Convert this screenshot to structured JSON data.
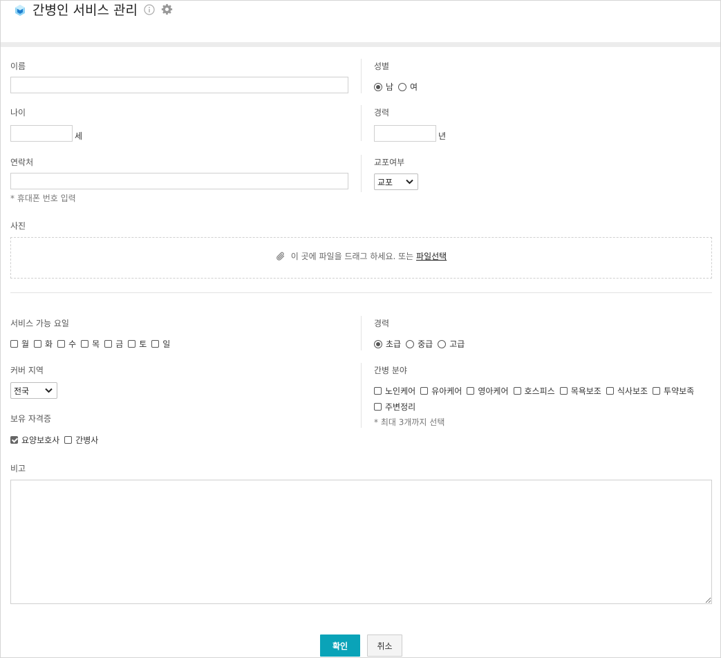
{
  "header": {
    "title": "간병인 서비스 관리"
  },
  "icons": {
    "logo": "app-logo-icon",
    "info": "info-icon",
    "settings": "gear-icon",
    "attach": "paperclip-icon",
    "dropdown": "chevron-down-icon"
  },
  "colors": {
    "primary": "#0aa3b8",
    "header_bar": "#ececec"
  },
  "form": {
    "name": {
      "label": "이름",
      "value": ""
    },
    "gender": {
      "label": "성별",
      "options": [
        "남",
        "여"
      ],
      "selected": "남"
    },
    "age": {
      "label": "나이",
      "value": "",
      "unit": "세"
    },
    "career_years": {
      "label": "경력",
      "value": "",
      "unit": "년"
    },
    "contact": {
      "label": "연락처",
      "value": "",
      "note": "* 휴대폰 번호 입력"
    },
    "korean_resident": {
      "label": "교포여부",
      "selected": "교포"
    },
    "photo": {
      "label": "사진",
      "drop_text": "이 곳에 파일을 드래그 하세요. 또는",
      "link_text": "파일선택"
    },
    "service_days": {
      "label": "서비스 가능 요일",
      "options": [
        "월",
        "화",
        "수",
        "목",
        "금",
        "토",
        "일"
      ]
    },
    "career_level": {
      "label": "경력",
      "options": [
        "초급",
        "중급",
        "고급"
      ],
      "selected": "초급"
    },
    "region": {
      "label": "커버 지역",
      "selected": "전국"
    },
    "care_field": {
      "label": "간병 분야",
      "options": [
        "노인케어",
        "유아케어",
        "영아케어",
        "호스피스",
        "목욕보조",
        "식사보조",
        "투약보족",
        "주변정리"
      ],
      "note": "* 최대 3개까지 선택"
    },
    "certificates": {
      "label": "보유 자격증",
      "options": [
        "요양보호사",
        "간병사"
      ],
      "checked": [
        "요양보호사"
      ]
    },
    "memo": {
      "label": "비고",
      "value": ""
    }
  },
  "buttons": {
    "confirm": "확인",
    "cancel": "취소"
  }
}
